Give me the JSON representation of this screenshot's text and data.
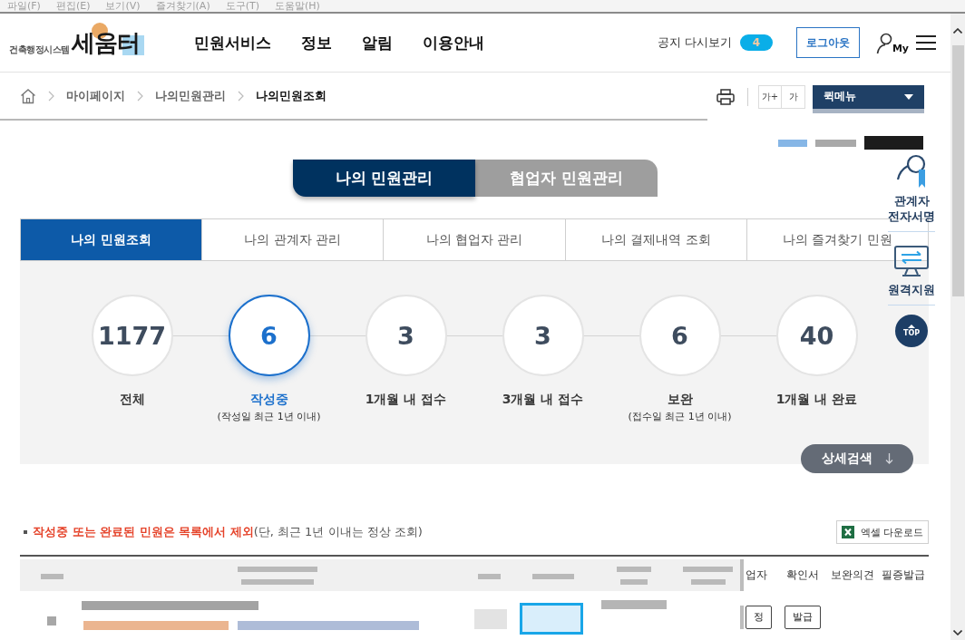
{
  "browser_menu": [
    "파일(F)",
    "편집(E)",
    "보기(V)",
    "즐겨찾기(A)",
    "도구(T)",
    "도움말(H)"
  ],
  "header": {
    "logo": {
      "title": "세움터",
      "subtitle": "건축행정시스템"
    },
    "nav": [
      "민원서비스",
      "정보",
      "알림",
      "이용안내"
    ],
    "notice": {
      "label": "공지 다시보기",
      "count": "4"
    },
    "logout": "로그아웃",
    "my_label": "My"
  },
  "breadcrumb": [
    {
      "label": "마이페이지",
      "selected": false
    },
    {
      "label": "나의민원관리",
      "selected": false
    },
    {
      "label": "나의민원조회",
      "selected": true
    }
  ],
  "tools": {
    "font_buttons": [
      "가+",
      "가"
    ],
    "quick_menu": "퀵메뉴"
  },
  "main_tabs": [
    {
      "label": "나의 민원관리",
      "selected": true
    },
    {
      "label": "협업자 민원관리",
      "selected": false
    }
  ],
  "sub_tabs": [
    {
      "label": "나의 민원조회",
      "selected": true
    },
    {
      "label": "나의 관계자 관리",
      "selected": false
    },
    {
      "label": "나의 협업자 관리",
      "selected": false
    },
    {
      "label": "나의 결제내역 조회",
      "selected": false
    },
    {
      "label": "나의 즐겨찾기 민원",
      "selected": false
    }
  ],
  "stats": [
    {
      "count": "1177",
      "label": "전체",
      "selected": false
    },
    {
      "count": "6",
      "label": "작성중",
      "note": "(작성일 최근 1년 이내)",
      "selected": true
    },
    {
      "count": "3",
      "label": "1개월 내 접수",
      "selected": false
    },
    {
      "count": "3",
      "label": "3개월 내 접수",
      "selected": false
    },
    {
      "count": "6",
      "label": "보완",
      "note": "(접수일 최근 1년 이내)",
      "selected": false
    },
    {
      "count": "40",
      "label": "1개월 내 완료",
      "selected": false
    }
  ],
  "detail_search": "상세검색",
  "notice_line": {
    "highlight": "작성중 또는 완료된 민원은 목록에서 제외",
    "rest": "(단, 최근 1년 이내는 정상 조회)"
  },
  "excel_button": "엑셀 다운로드",
  "table": {
    "columns": [
      "업자",
      "확인서",
      "보완의견",
      "필증발급"
    ],
    "rows": [
      {
        "buttons": [
          "정",
          "발급"
        ]
      }
    ]
  },
  "quick_panel": {
    "items": [
      {
        "kind": "signature",
        "label": "관계자 전자서명"
      },
      {
        "kind": "remote",
        "label": "원격지원"
      }
    ],
    "top": "TOP"
  }
}
